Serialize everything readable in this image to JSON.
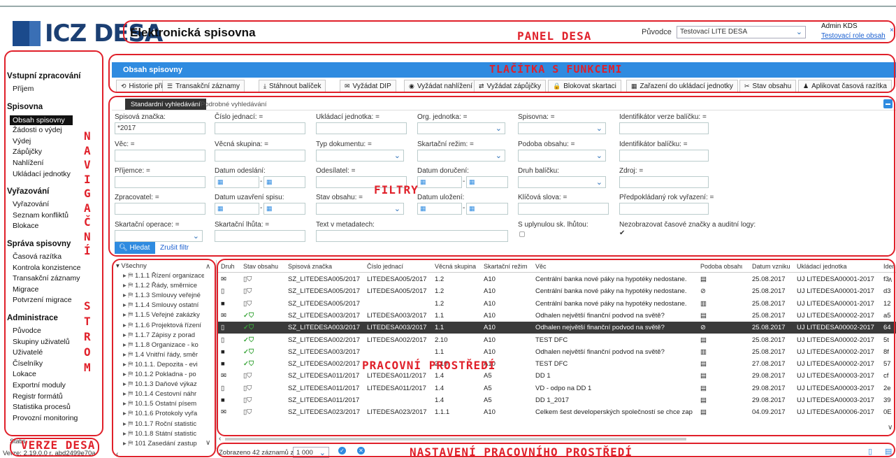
{
  "header": {
    "logo_text": "ICZ DESA",
    "app_title": "Elektronická spisovna",
    "puvodce_label": "Původce",
    "puvodce_value": "Testovací LITE DESA",
    "user_name": "Admin KDS",
    "user_role": "Testovací role obsah",
    "close": "×"
  },
  "annotations": {
    "panel": "PANEL DESA",
    "buttons": "TLAČÍTKA S FUNKCEMI",
    "filters": "FILTRY",
    "navigace": [
      "N",
      "A",
      "V",
      "I",
      "G",
      "A",
      "Č",
      "N",
      "Í"
    ],
    "strom": [
      "S",
      "T",
      "R",
      "O",
      "M"
    ],
    "workspace": "PRACOVNÍ PROSTŘEDÍ",
    "version": "VERZE DESA",
    "settings": "NASTAVENÍ PRACOVNÍHO PROSTŘEDÍ"
  },
  "sidebar": {
    "sections": [
      {
        "title": "Vstupní zpracování",
        "items": [
          "Příjem"
        ]
      },
      {
        "title": "Spisovna",
        "items": [
          "Obsah spisovny",
          "Žádosti o výdej",
          "Výdej",
          "Zápůjčky",
          "Nahlížení",
          "Ukládací jednotky"
        ]
      },
      {
        "title": "Vyřazování",
        "items": [
          "Vyřazování",
          "Seznam konfliktů",
          "Blokace"
        ]
      },
      {
        "title": "Správa spisovny",
        "items": [
          "Časová razítka",
          "Kontrola konzistence",
          "Transakční záznamy",
          "Migrace",
          "Potvrzení migrace"
        ]
      },
      {
        "title": "Administrace",
        "items": [
          "Původce",
          "Skupiny uživatelů",
          "Uživatelé",
          "Číselníky",
          "Lokace",
          "Exportní moduly",
          "Registr formátů",
          "Statistika procesů",
          "Provozní monitoring"
        ]
      }
    ],
    "active": "Obsah spisovny",
    "stat_label": "Statis",
    "version": "Verze: 2.19.0.0 r. abd2499e70a"
  },
  "content": {
    "title": "Obsah spisovny",
    "toolbar": [
      {
        "icon": "history-icon",
        "glyph": "⟲",
        "label": "Historie příjmu"
      },
      {
        "icon": "list-icon",
        "glyph": "☰",
        "label": "Transakční záznamy"
      },
      {
        "icon": "download-icon",
        "glyph": "⤓",
        "label": "Stáhnout balíček"
      },
      {
        "icon": "request-icon",
        "glyph": "✉",
        "label": "Vyžádat DIP"
      },
      {
        "icon": "eye-icon",
        "glyph": "◉",
        "label": "Vyžádat nahlížení"
      },
      {
        "icon": "swap-icon",
        "glyph": "⇄",
        "label": "Vyžádat zápůjčky"
      },
      {
        "icon": "lock-icon",
        "glyph": "🔒",
        "label": "Blokovat skartaci"
      },
      {
        "icon": "box-icon",
        "glyph": "▦",
        "label": "Zařazení do ukládací jednotky"
      },
      {
        "icon": "tools-icon",
        "glyph": "✂",
        "label": "Stav obsahu"
      },
      {
        "icon": "stamp-icon",
        "glyph": "♟",
        "label": "Aplikovat časová razítka"
      }
    ],
    "filter_tabs": [
      "Standardní vyhledávání",
      "Podrobné vyhledávání"
    ],
    "filters": {
      "spisova_znacka": "Spisová značka:",
      "spisova_znacka_value": "*2017",
      "cislo_jednaci": "Číslo jednací:",
      "ukladaci_jednotka": "Ukládací jednotka:",
      "org_jednotka": "Org. jednotka:",
      "spisovna": "Spisovna:",
      "id_verze": "Identifikátor verze balíčku:",
      "vec": "Věc:",
      "vecna_skupina": "Věcná skupina:",
      "typ_dokumentu": "Typ dokumentu:",
      "skartacni_rezim": "Skartační režim:",
      "podoba_obsahu": "Podoba obsahu:",
      "id_balicku": "Identifikátor balíčku:",
      "prijemce": "Příjemce:",
      "datum_odeslani": "Datum odeslání:",
      "odesilatel": "Odesílatel:",
      "datum_doruceni": "Datum doručení:",
      "druh_balicku": "Druh balíčku:",
      "zdroj": "Zdroj:",
      "zpracovatel": "Zpracovatel:",
      "datum_uzavreni": "Datum uzavření spisu:",
      "stav_obsahu": "Stav obsahu:",
      "datum_ulozeni": "Datum uložení:",
      "klicova_slova": "Klíčová slova:",
      "predpokladany_rok": "Předpokládaný rok vyřazení:",
      "skartacni_operace": "Skartační operace:",
      "skartacni_lhuta": "Skartační lhůta:",
      "text_metadata": "Text v metadatech:",
      "s_uplynulou": "S uplynulou sk. lhůtou:",
      "nezobrazovat": "Nezobrazovat časové značky a auditní logy:",
      "op": "=",
      "dash": "-",
      "btn_search": "Hledat",
      "btn_clear": "Zrušit filtr"
    },
    "tree": {
      "root": "Všechny",
      "items": [
        "1.1.1 Řízení organizace",
        "1.1.2 Řády, směrnice",
        "1.1.3 Smlouvy veřejné",
        "1.1.4 Smlouvy ostatní",
        "1.1.5 Veřejné zakázky",
        "1.1.6 Projektová řízení",
        "1.1.7 Zápisy z porad",
        "1.1.8 Organizace - ko",
        "1.4 Vnitřní řády, směr",
        "10.1.1. Depozita - evi",
        "10.1.2 Pokladna - po",
        "10.1.3 Daňové výkaz",
        "10.1.4 Cestovní náhr",
        "10.1.5 Ostatní písem",
        "10.1.6 Protokoly vyřa",
        "10.1.7 Roční statistic",
        "10.1.8 Státní statistic",
        "101 Zasedání zastup"
      ]
    },
    "table": {
      "headers": [
        "Druh",
        "Stav obsahu",
        "Spisová značka",
        "Číslo jednací",
        "Věcná skupina",
        "Skartační režim",
        "Věc",
        "Podoba obsahu",
        "Datum vzniku",
        "Ukládací jednotka",
        "Ident"
      ],
      "rows": [
        {
          "druh": "✉",
          "stav": "▯⛉",
          "sz": "SZ_LITEDESA005/2017",
          "cj": "LITEDESA005/2017",
          "vs": "1.2",
          "sr": "A10",
          "vec": "Centrální banka nové páky na hypotéky nedostane.",
          "po": "▤",
          "dv": "25.08.2017",
          "uj": "UJ LITEDESA00001-2017",
          "id": "f3"
        },
        {
          "druh": "▯",
          "stav": "▯⛉",
          "sz": "SZ_LITEDESA005/2017",
          "cj": "LITEDESA005/2017",
          "vs": "1.2",
          "sr": "A10",
          "vec": "Centrální banka nové páky na hypotéky nedostane.",
          "po": "⊘",
          "dv": "25.08.2017",
          "uj": "UJ LITEDESA00001-2017",
          "id": "d3"
        },
        {
          "druh": "■",
          "stav": "▯⛉",
          "sz": "SZ_LITEDESA005/2017",
          "cj": "",
          "vs": "1.2",
          "sr": "A10",
          "vec": "Centrální banka nové páky na hypotéky nedostane.",
          "po": "▥",
          "dv": "25.08.2017",
          "uj": "UJ LITEDESA00001-2017",
          "id": "12"
        },
        {
          "druh": "✉",
          "stav": "✓⛉",
          "sz": "SZ_LITEDESA003/2017",
          "cj": "LITEDESA003/2017",
          "vs": "1.1",
          "sr": "A10",
          "vec": "Odhalen největší finanční podvod na světě?",
          "po": "▤",
          "dv": "25.08.2017",
          "uj": "UJ LITEDESA00002-2017",
          "id": "a5"
        },
        {
          "druh": "▯",
          "stav": "✓⛉",
          "sz": "SZ_LITEDESA003/2017",
          "cj": "LITEDESA003/2017",
          "vs": "1.1",
          "sr": "A10",
          "vec": "Odhalen největší finanční podvod na světě?",
          "po": "⊘",
          "dv": "25.08.2017",
          "uj": "UJ LITEDESA00002-2017",
          "id": "64"
        },
        {
          "druh": "▯",
          "stav": "✓⛉",
          "sz": "SZ_LITEDESA002/2017",
          "cj": "LITEDESA002/2017",
          "vs": "2.10",
          "sr": "A10",
          "vec": "TEST DFC",
          "po": "▤",
          "dv": "25.08.2017",
          "uj": "UJ LITEDESA00002-2017",
          "id": "5t"
        },
        {
          "druh": "■",
          "stav": "✓⛉",
          "sz": "SZ_LITEDESA003/2017",
          "cj": "",
          "vs": "1.1",
          "sr": "A10",
          "vec": "Odhalen největší finanční podvod na světě?",
          "po": "▥",
          "dv": "25.08.2017",
          "uj": "UJ LITEDESA00002-2017",
          "id": "8f"
        },
        {
          "druh": "■",
          "stav": "✓⛉",
          "sz": "SZ_LITEDESA002/2017",
          "cj": "",
          "vs": "2.10",
          "sr": "A10",
          "vec": "TEST DFC",
          "po": "▤",
          "dv": "27.08.2017",
          "uj": "UJ LITEDESA00002-2017",
          "id": "57"
        },
        {
          "druh": "✉",
          "stav": "▯⛉",
          "sz": "SZ_LITEDESA011/2017",
          "cj": "LITEDESA011/2017",
          "vs": "1.4",
          "sr": "A5",
          "vec": "DD 1",
          "po": "▤",
          "dv": "29.08.2017",
          "uj": "UJ LITEDESA00003-2017",
          "id": "cf"
        },
        {
          "druh": "▯",
          "stav": "▯⛉",
          "sz": "SZ_LITEDESA011/2017",
          "cj": "LITEDESA011/2017",
          "vs": "1.4",
          "sr": "A5",
          "vec": "VD - odpo na DD 1",
          "po": "▤",
          "dv": "29.08.2017",
          "uj": "UJ LITEDESA00003-2017",
          "id": "2e"
        },
        {
          "druh": "■",
          "stav": "▯⛉",
          "sz": "SZ_LITEDESA011/2017",
          "cj": "",
          "vs": "1.4",
          "sr": "A5",
          "vec": "DD 1_2017",
          "po": "▤",
          "dv": "29.08.2017",
          "uj": "UJ LITEDESA00003-2017",
          "id": "39"
        },
        {
          "druh": "✉",
          "stav": "▯⛉",
          "sz": "SZ_LITEDESA023/2017",
          "cj": "LITEDESA023/2017",
          "vs": "1.1.1",
          "sr": "A10",
          "vec": "Celkem šest developerských společností se chce zap",
          "po": "▤",
          "dv": "04.09.2017",
          "uj": "UJ LITEDESA00006-2017",
          "id": "0E"
        }
      ],
      "selected_row": 4
    },
    "footer": {
      "count_text": "Zobrazeno 42 záznamů z",
      "page_size": "1 000"
    }
  }
}
